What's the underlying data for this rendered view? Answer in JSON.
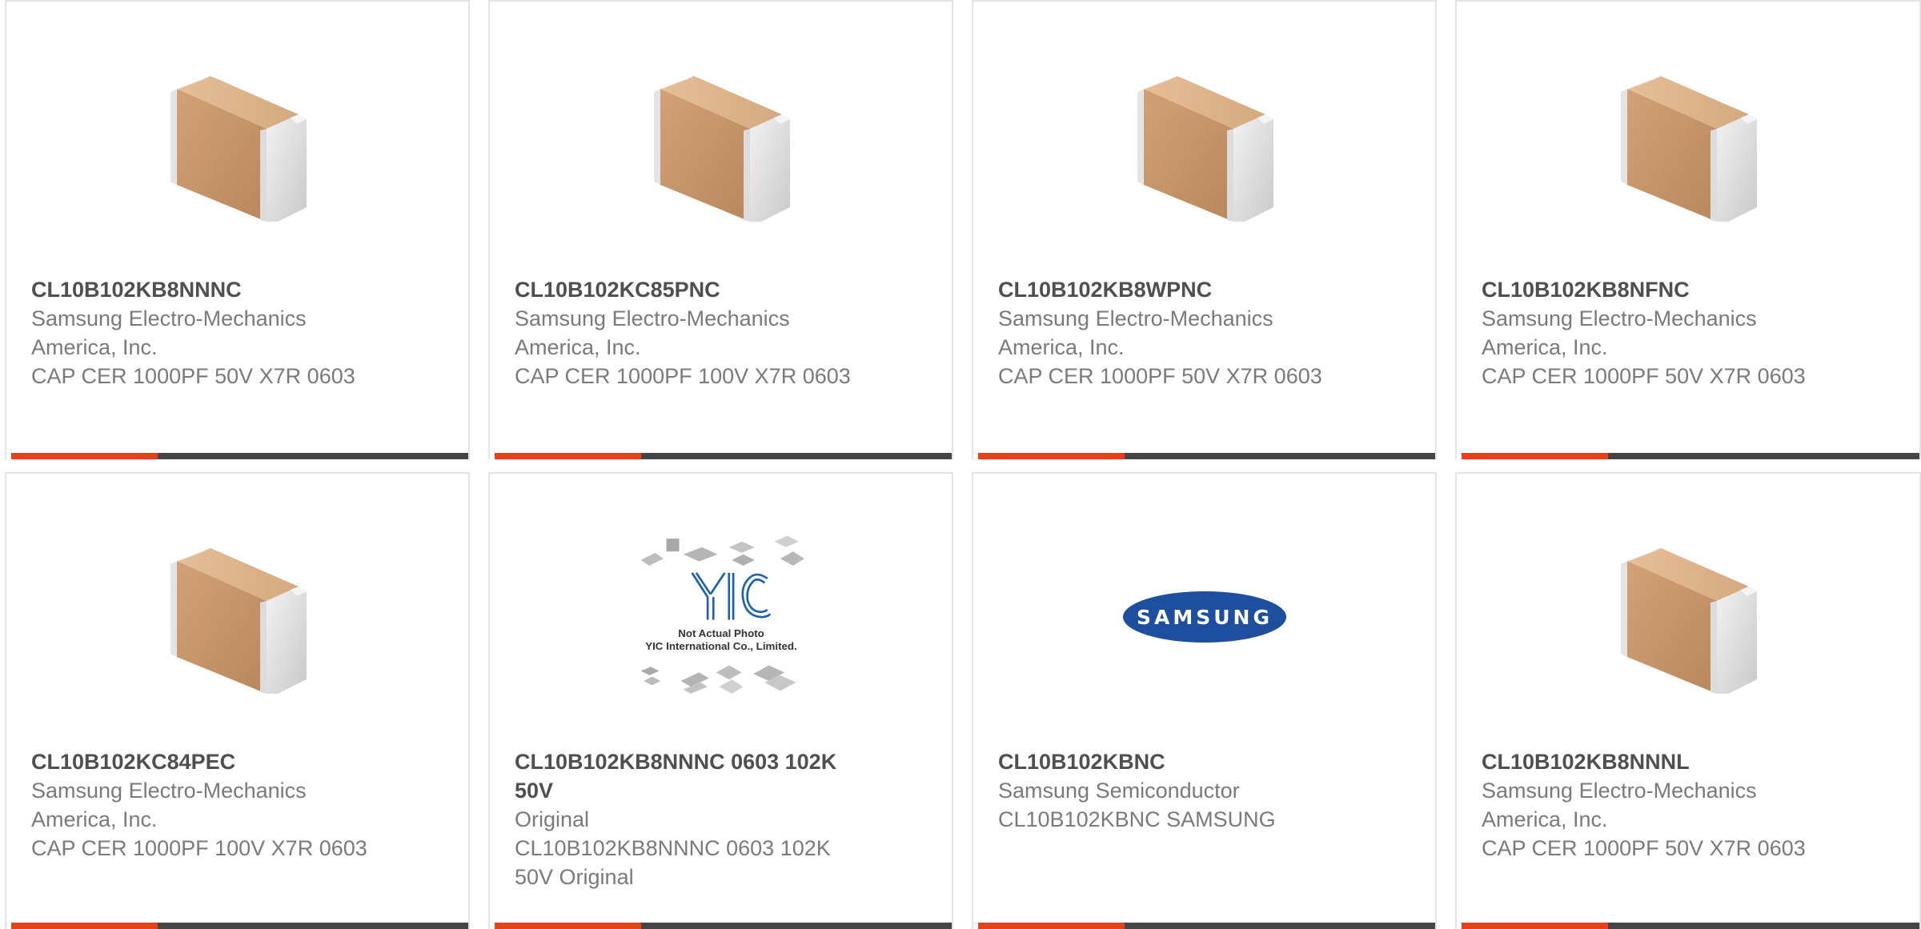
{
  "colors": {
    "accent": "#e8401b",
    "bar": "#454545",
    "border": "#e3e3e3",
    "part_number": "#4f4f4f",
    "text": "#7a7a7a",
    "samsung_blue": "#1d4f9e"
  },
  "products": [
    {
      "part_number": "CL10B102KB8NNNC",
      "manufacturer": "Samsung Electro-Mechanics America, Inc.",
      "description": "CAP CER 1000PF 50V X7R 0603",
      "image": "ceramic-capacitor-icon"
    },
    {
      "part_number": "CL10B102KC85PNC",
      "manufacturer": "Samsung Electro-Mechanics America, Inc.",
      "description": "CAP CER 1000PF 100V X7R 0603",
      "image": "ceramic-capacitor-icon"
    },
    {
      "part_number": "CL10B102KB8WPNC",
      "manufacturer": "Samsung Electro-Mechanics America, Inc.",
      "description": "CAP CER 1000PF 50V X7R 0603",
      "image": "ceramic-capacitor-icon"
    },
    {
      "part_number": "CL10B102KB8NFNC",
      "manufacturer": "Samsung Electro-Mechanics America, Inc.",
      "description": "CAP CER 1000PF 50V X7R 0603",
      "image": "ceramic-capacitor-icon"
    },
    {
      "part_number": "CL10B102KC84PEC",
      "manufacturer": "Samsung Electro-Mechanics America, Inc.",
      "description": "CAP CER 1000PF 100V X7R 0603",
      "image": "ceramic-capacitor-icon"
    },
    {
      "part_number": "CL10B102KB8NNNC 0603 102K 50V",
      "manufacturer": "Original",
      "description": "CL10B102KB8NNNC 0603 102K 50V Original",
      "image": "yic-placeholder-icon",
      "image_text": {
        "logo": "YIC",
        "line1": "Not Actual Photo",
        "line2": "YIC International Co., Limited."
      }
    },
    {
      "part_number": "CL10B102KBNC",
      "manufacturer": "Samsung Semiconductor",
      "description": "CL10B102KBNC SAMSUNG",
      "image": "samsung-logo-icon",
      "image_text": {
        "logo": "SAMSUNG"
      }
    },
    {
      "part_number": "CL10B102KB8NNNL",
      "manufacturer": "Samsung Electro-Mechanics America, Inc.",
      "description": "CAP CER 1000PF 50V X7R 0603",
      "image": "ceramic-capacitor-icon"
    }
  ]
}
